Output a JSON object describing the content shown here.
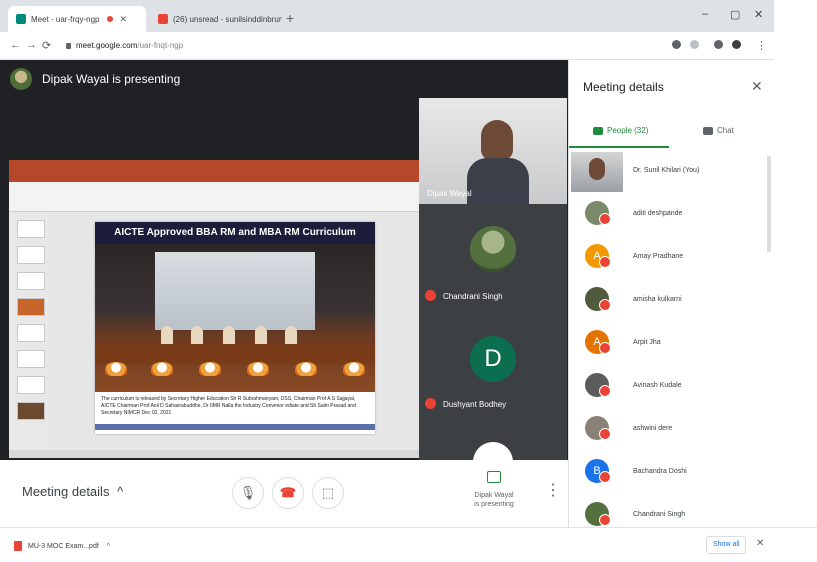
{
  "browser": {
    "tabs": [
      {
        "title": "Meet - uar-frqy-ngp"
      },
      {
        "title": "(26) unsread - sunilsinddinbrunkq"
      }
    ],
    "new_tab": "+",
    "url_host": "meet.google.com",
    "url_path": "/uar-fnqt-ngp",
    "window_controls": {
      "minimize": "–",
      "maximize": "▢",
      "close": "✕"
    }
  },
  "meet": {
    "presenter_banner": "Dipak Wayal is presenting",
    "slide": {
      "title": "AICTE Approved BBA RM and MBA RM Curriculum",
      "caption": "The curriculum is released by Secretary Higher Education Sh R Subrahmanyam, DSS, Chairman Prof A S Sajjayal, AICTE Chairman Prof Anil D Sahasrabuddhe, Dr IIMR Nalla the Industry Convenor ediate and Sh Saito Prasad and Secretary NIMCR Dec 02, 2021"
    },
    "tiles": [
      {
        "name": "Dipak Wayal"
      },
      {
        "name": "Chandrani Singh"
      },
      {
        "name": "Dushyant Bodhey",
        "letter": "D"
      }
    ],
    "controls": {
      "meeting_details": "Meeting details",
      "meeting_details_chevron": "^",
      "mic": "🎙",
      "end_call": "☎",
      "camera": "⬚",
      "present_line1": "Dipak Wayal",
      "present_line2": "is presenting",
      "more": "⋮"
    }
  },
  "panel": {
    "title": "Meeting details",
    "close": "✕",
    "tab_people": "People (32)",
    "tab_chat": "Chat",
    "participants": [
      {
        "name": "Dr. Sunil Khilari (You)",
        "kind": "self"
      },
      {
        "name": "aditi deshpande",
        "kind": "photo",
        "color": "#7a8a6a"
      },
      {
        "name": "Amay Pradhane",
        "kind": "letter",
        "letter": "A",
        "color": "#f29900"
      },
      {
        "name": "amisha kulkarni",
        "kind": "photo",
        "color": "#4f5b3a"
      },
      {
        "name": "Arpit Jha",
        "kind": "letter",
        "letter": "A",
        "color": "#e37400"
      },
      {
        "name": "Avinash Kudale",
        "kind": "photo",
        "color": "#5c5c5c"
      },
      {
        "name": "ashwini dere",
        "kind": "photo",
        "color": "#8a8178"
      },
      {
        "name": "Bachandra Doshi",
        "kind": "letter",
        "letter": "B",
        "color": "#1a73e8"
      },
      {
        "name": "Chandrani Singh",
        "kind": "photo",
        "color": "#55703f"
      }
    ]
  },
  "shelf": {
    "file": "MU-3 MOC Exam...pdf",
    "caret": "^",
    "show_all": "Show all",
    "close": "✕"
  },
  "colors": {
    "accent": "#1e8e3e",
    "mute": "#ea4335",
    "meet_bg": "#202124"
  }
}
